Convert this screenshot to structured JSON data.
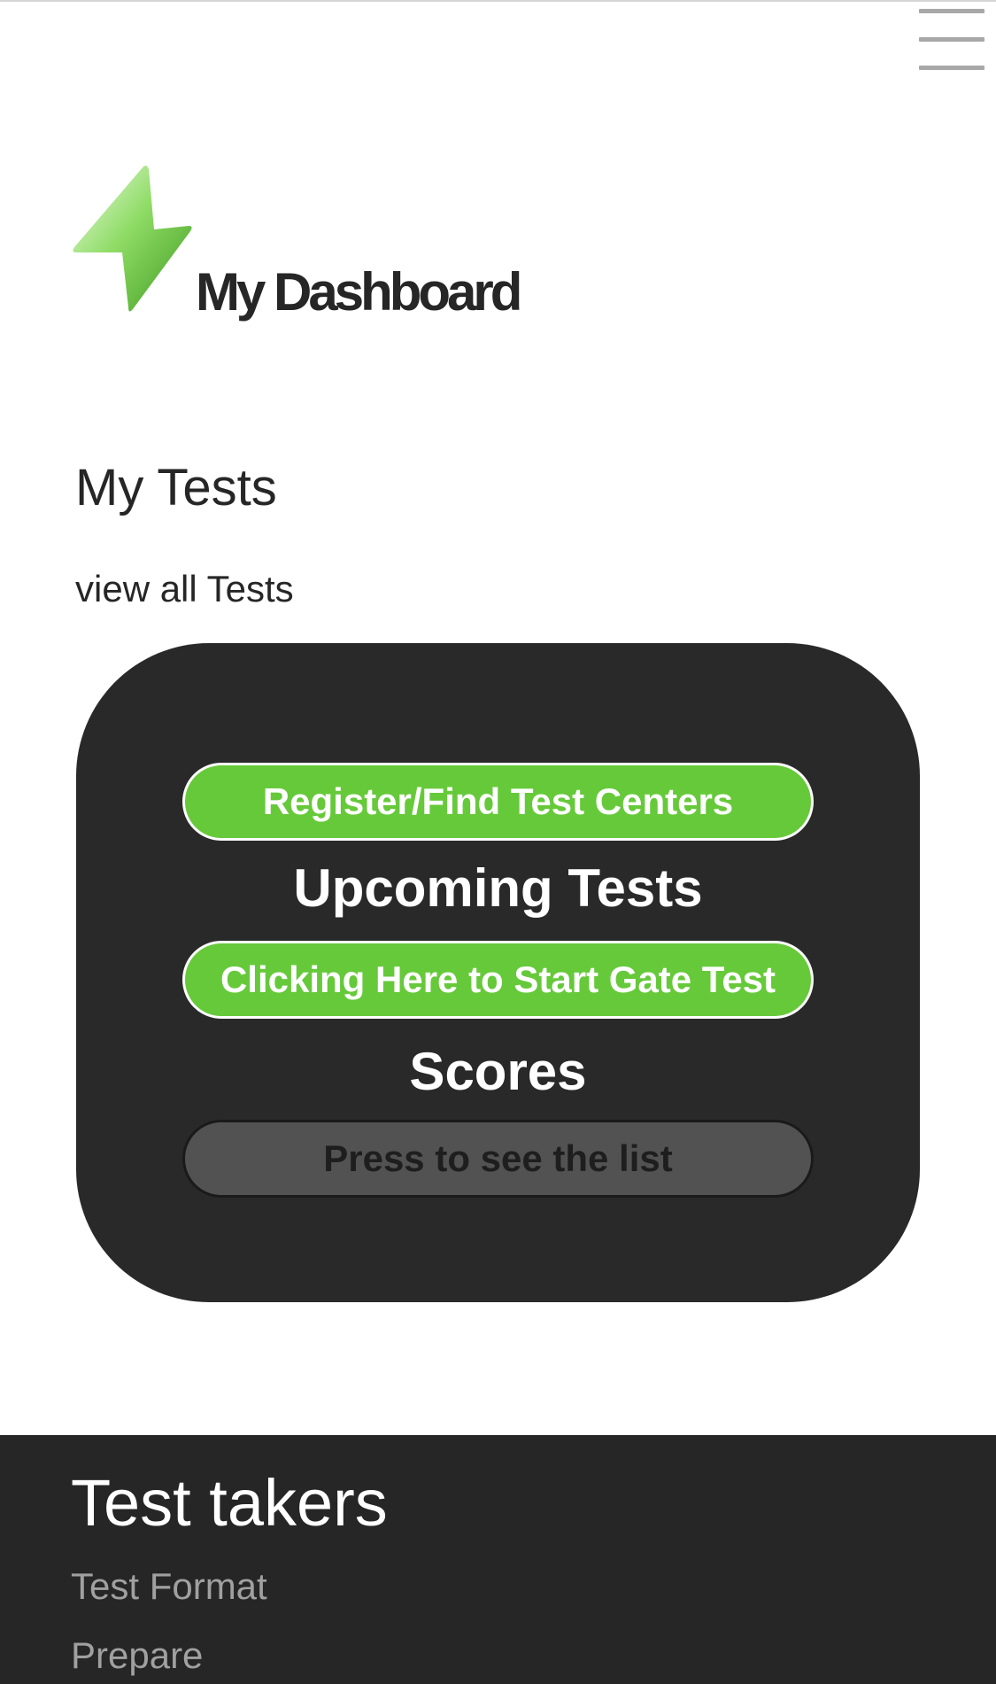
{
  "header": {
    "menu_icon": "hamburger-menu-icon",
    "logo_icon": "lightning-bolt-icon",
    "title": "My Dashboard"
  },
  "my_tests": {
    "title": "My Tests",
    "view_all_label": "view all Tests",
    "card": {
      "register_button_label": "Register/Find Test Centers",
      "upcoming_heading": "Upcoming Tests",
      "start_button_label": "Clicking Here to Start Gate Test",
      "scores_heading": "Scores",
      "list_button_label": "Press to see the list"
    }
  },
  "footer": {
    "title": "Test takers",
    "links": [
      "Test Format",
      "Prepare"
    ]
  },
  "colors": {
    "accent_green": "#66c93a",
    "card_background": "#292929",
    "footer_background": "#262626",
    "text_dark": "#262626",
    "footer_link": "#a0a0a0",
    "menu_icon": "#a8a8a8"
  }
}
